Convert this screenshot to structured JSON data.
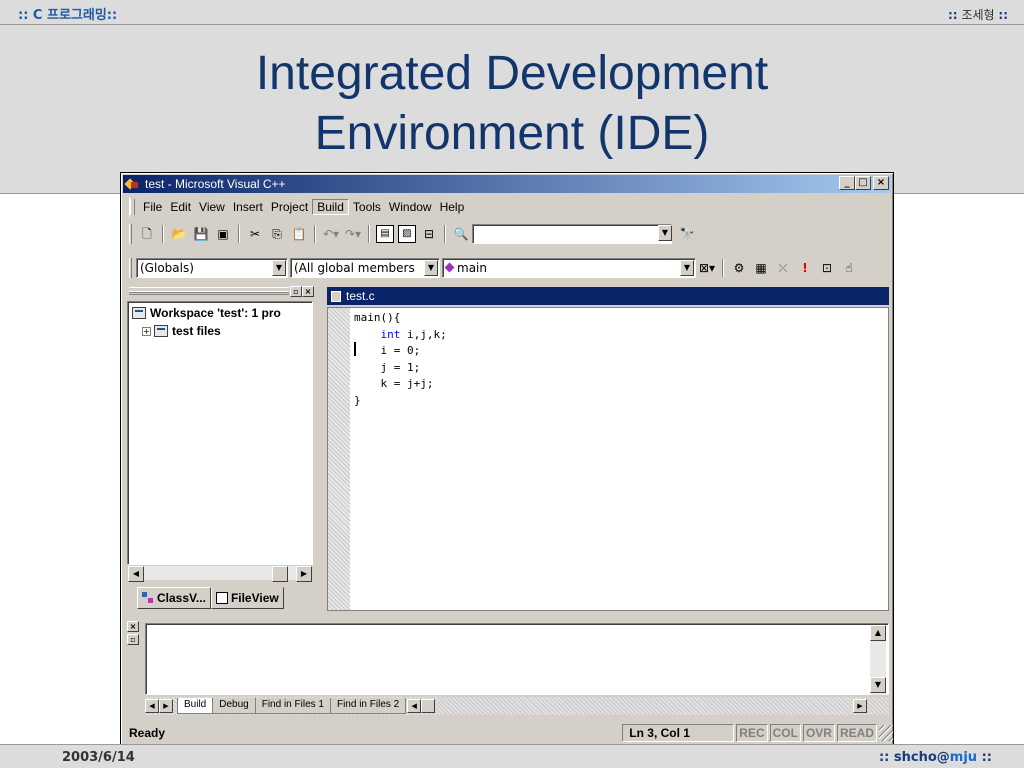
{
  "slide": {
    "header_left": ":: C 프로그래밍::",
    "header_right_prefix": "::",
    "header_right_name": "조세형",
    "header_right_suffix": "::",
    "title_line1": "Integrated Development",
    "title_line2": "Environment (IDE)",
    "footer_date": "2003/6/14",
    "footer_prefix": "::",
    "footer_user": "shcho",
    "footer_at": "@",
    "footer_domain": "mju",
    "footer_suffix": "::"
  },
  "window": {
    "title": "test - Microsoft Visual C++",
    "btn_min": "_",
    "btn_max": "□",
    "btn_close": "×"
  },
  "menu": {
    "items": [
      "File",
      "Edit",
      "View",
      "Insert",
      "Project",
      "Build",
      "Tools",
      "Window",
      "Help"
    ],
    "active": "Build"
  },
  "toolbar": {
    "icons": {
      "new": "new-file-icon",
      "open": "open-folder-icon",
      "save": "save-icon",
      "save_all": "save-all-icon",
      "cut": "cut-icon",
      "copy": "copy-icon",
      "paste": "paste-icon",
      "undo": "undo-icon",
      "redo": "redo-icon",
      "workspace": "workspace-icon",
      "output": "output-icon",
      "windows": "window-list-icon",
      "find_files": "find-in-files-icon",
      "find": "find-icon"
    },
    "search_value": ""
  },
  "wizardbar": {
    "class_combo": "(Globals)",
    "filter_combo": "(All global members",
    "member_combo": "main",
    "icons": {
      "action": "wizard-action-icon",
      "compile": "compile-icon",
      "build": "build-icon",
      "stop": "stop-build-icon",
      "execute": "execute-icon",
      "insert_breakpoint": "breakpoint-icon",
      "go": "go-icon"
    },
    "execute_glyph": "!"
  },
  "workspace": {
    "root": "Workspace 'test': 1 pro",
    "child": "test files",
    "expand": "⊞",
    "tabs": [
      "ClassV...",
      "FileView"
    ],
    "active_tab": "FileView"
  },
  "editor": {
    "filename": "test.c",
    "code": {
      "line1": "main(){",
      "line2_kw": "int",
      "line2_rest": " i,j,k;",
      "line3": "",
      "line4": "    i = 0;",
      "line5": "    j = 1;",
      "line6": "    k = j+j;",
      "line7": "}"
    }
  },
  "output": {
    "tabs": [
      "Build",
      "Debug",
      "Find in Files 1",
      "Find in Files 2"
    ],
    "active_tab": "Build"
  },
  "status": {
    "message": "Ready",
    "position": "Ln 3, Col 1",
    "rec": "REC",
    "col": "COL",
    "ovr": "OVR",
    "read": "READ"
  }
}
